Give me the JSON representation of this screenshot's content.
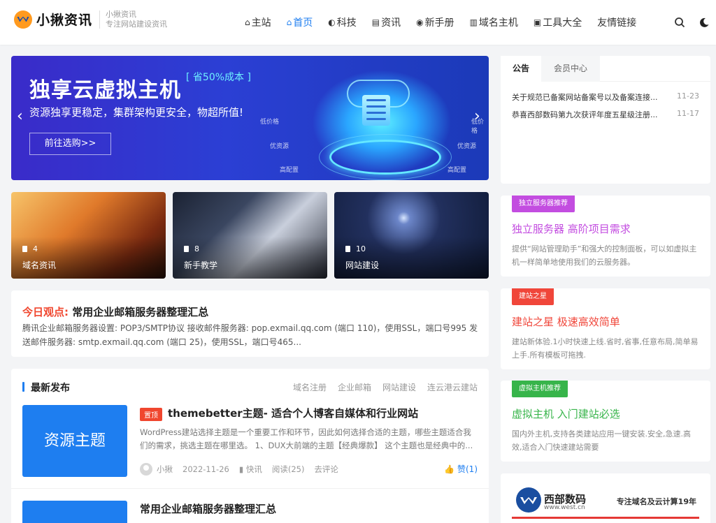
{
  "header": {
    "logo_name": "小揪资讯",
    "logo_sub1": "小揪资讯",
    "logo_sub2": "专注网站建设资讯",
    "nav": [
      {
        "label": "主站",
        "icon": "home-icon"
      },
      {
        "label": "首页",
        "icon": "home-icon",
        "active": true
      },
      {
        "label": "科技",
        "icon": "globe-icon"
      },
      {
        "label": "资讯",
        "icon": "document-icon"
      },
      {
        "label": "新手册",
        "icon": "compass-icon"
      },
      {
        "label": "域名主机",
        "icon": "server-icon"
      },
      {
        "label": "工具大全",
        "icon": "toolbox-icon"
      },
      {
        "label": "友情链接",
        "icon": ""
      }
    ]
  },
  "banner": {
    "title": "独享云虚拟主机",
    "tag": "[ 省50%成本 ]",
    "desc": "资源独享更稳定，集群架构更安全，物超所值!",
    "button": "前往选购>>",
    "labels": [
      "低价格",
      "优资源",
      "高配置",
      "低价格",
      "优资源",
      "高配置"
    ]
  },
  "categories": [
    {
      "count": "4",
      "name": "域名资讯"
    },
    {
      "count": "8",
      "name": "新手教学"
    },
    {
      "count": "10",
      "name": "网站建设"
    }
  ],
  "today": {
    "label": "今日观点:",
    "title": "常用企业邮箱服务器整理汇总",
    "text": "腾讯企业邮箱服务器设置: POP3/SMTP协议 接收邮件服务器: pop.exmail.qq.com (端口 110)，使用SSL，端口号995 发送邮件服务器: smtp.exmail.qq.com (端口 25)，使用SSL，端口号465..."
  },
  "latest": {
    "heading": "最新发布",
    "tabs": [
      "域名注册",
      "企业邮箱",
      "网站建设",
      "连云港云建站"
    ],
    "post1": {
      "thumb_text": "资源主题",
      "badge": "置顶",
      "title": "themebetter主题- 适合个人博客自媒体和行业网站",
      "excerpt": "WordPress建站选择主题是一个重要工作和环节，因此如何选择合适的主题，哪些主题适合我们的需求，挑选主题在哪里选。 1、DUX大前端的主题【经典爆款】 这个主题也是经典中的...",
      "author": "小揪",
      "date": "2022-11-26",
      "category": "快讯",
      "views": "阅读(25)",
      "comment": "去评论",
      "like": "赞(1)"
    },
    "post2": {
      "title": "常用企业邮箱服务器整理汇总"
    }
  },
  "sidebar": {
    "tabs": [
      "公告",
      "会员中心"
    ],
    "notices": [
      {
        "title": "关于规范已备案网站备案号以及备案连接...",
        "date": "11-23"
      },
      {
        "title": "恭喜西部数码第九次获评年度五星级注册...",
        "date": "11-17"
      }
    ],
    "promos": [
      {
        "badge": "独立服务器推荐",
        "title": "独立服务器 高阶项目需求",
        "desc": "提供“网站管理助手”和强大的控制面板，可以如虚拟主机一样简单地使用我们的云服务器。",
        "color": "#c34de0"
      },
      {
        "badge": "建站之星",
        "title": "建站之星 极速高效简单",
        "desc": "建站新体验.1小时快速上线.省时,省事,任意布局,简单易上手.所有模板可拖拽.",
        "color": "#f0463a"
      },
      {
        "badge": "虚拟主机推荐",
        "title": "虚拟主机 入门建站必选",
        "desc": "国内外主机,支持各类建站应用一键安装.安全,急速.高效,适合入门快速建站需要",
        "color": "#37b44a"
      }
    ],
    "ad": {
      "name": "西部数码",
      "url": "www.west.cn",
      "slogan": "专注域名及云计算19年"
    }
  }
}
